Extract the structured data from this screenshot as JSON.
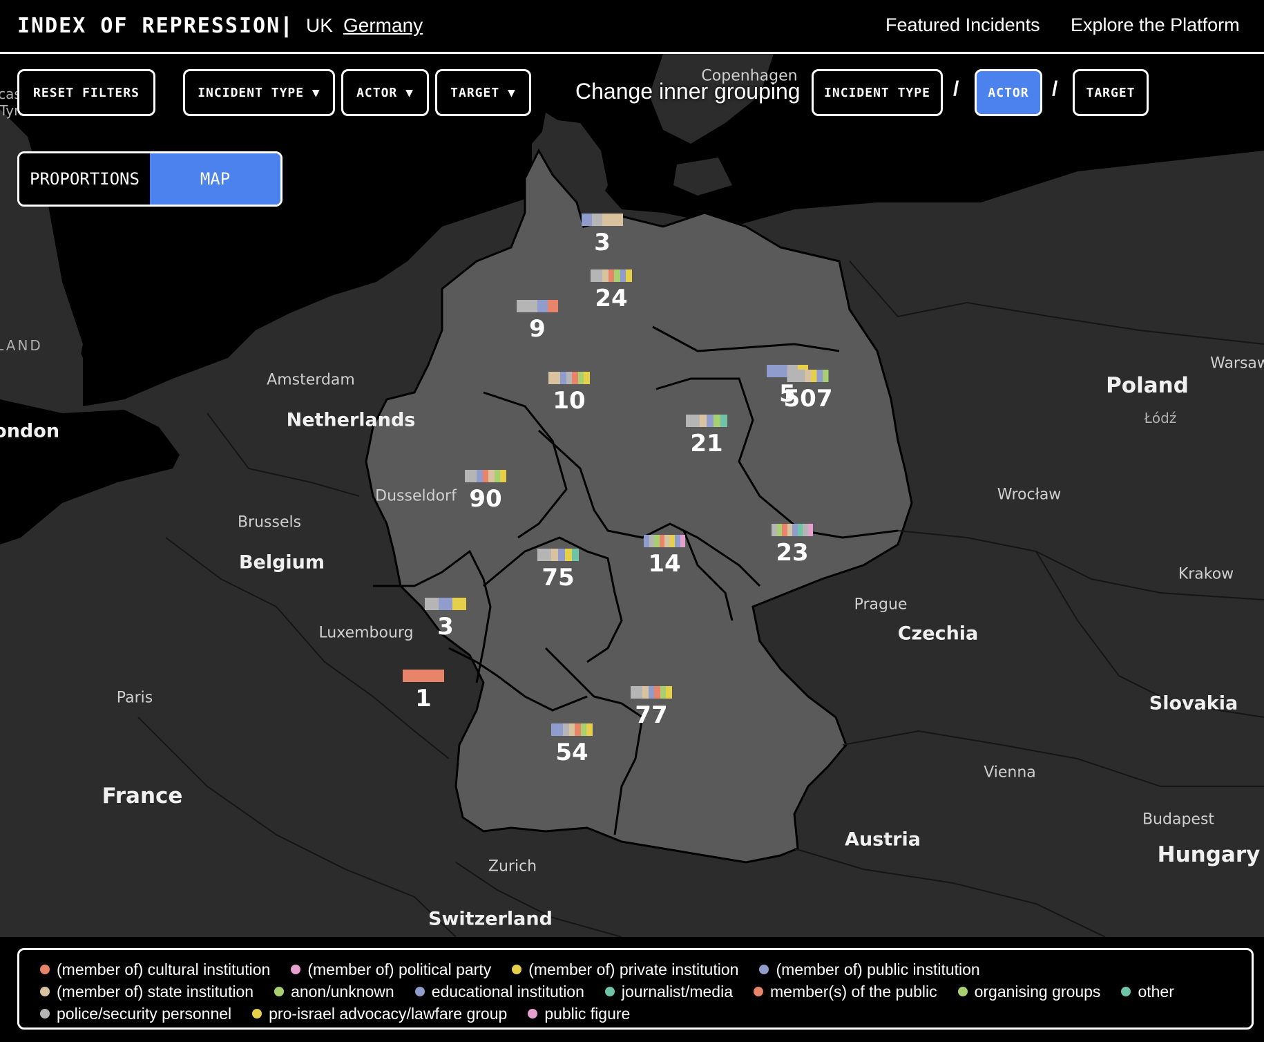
{
  "header": {
    "brand": "INDEX OF REPRESSION",
    "separator": "|",
    "countries": [
      "UK",
      "Germany"
    ],
    "active_country": "Germany",
    "nav": [
      "Featured Incidents",
      "Explore the Platform"
    ]
  },
  "controls": {
    "reset": "RESET FILTERS",
    "filters": [
      "INCIDENT TYPE ▼",
      "ACTOR ▼",
      "TARGET ▼"
    ],
    "change_label": "Change inner grouping",
    "grouping": [
      "INCIDENT TYPE",
      "ACTOR",
      "TARGET"
    ],
    "grouping_active": "ACTOR",
    "slash": "/",
    "view_toggle": [
      "PROPORTIONS",
      "MAP"
    ],
    "view_active": "MAP"
  },
  "map_labels": {
    "cities": [
      "Copenhagen",
      "Amsterdam",
      "Dusseldorf",
      "Brussels",
      "Luxembourg",
      "Paris",
      "Zurich",
      "Prague",
      "Vienna",
      "Budapest",
      "Wrocław",
      "Łódź",
      "Krakow",
      "Warsaw",
      "London"
    ],
    "countries": [
      "Netherlands",
      "Belgium",
      "France",
      "Switzerland",
      "Austria",
      "Czechia",
      "Poland",
      "Slovakia",
      "Hungary"
    ],
    "fragments": [
      "LAND",
      "cas",
      "Tyn"
    ]
  },
  "regions": [
    {
      "count": "3",
      "segments": [
        "#8f9ccc",
        "#b5b5b5",
        "#d9c2a0",
        "#d9c2a0"
      ]
    },
    {
      "count": "24",
      "segments": [
        "#b5b5b5",
        "#b5b5b5",
        "#d9c2a0",
        "#e8846a",
        "#a8d070",
        "#8f9ccc",
        "#e6d04a"
      ]
    },
    {
      "count": "9",
      "segments": [
        "#b5b5b5",
        "#b5b5b5",
        "#8f9ccc",
        "#e8846a"
      ]
    },
    {
      "count": "10",
      "segments": [
        "#d9c2a0",
        "#d9c2a0",
        "#8f9ccc",
        "#b5b5b5",
        "#e8846a",
        "#a8d070",
        "#e6d04a"
      ]
    },
    {
      "count": "5",
      "segments": [
        "#8f9ccc",
        "#8f9ccc",
        "#b5b5b5",
        "#e6d04a"
      ]
    },
    {
      "count": "507",
      "segments": [
        "#b5b5b5",
        "#b5b5b5",
        "#b5b5b5",
        "#d9c2a0",
        "#e6d04a",
        "#8f9ccc",
        "#a8d070"
      ]
    },
    {
      "count": "21",
      "segments": [
        "#b5b5b5",
        "#b5b5b5",
        "#d9c2a0",
        "#8f9ccc",
        "#a8d070",
        "#6fc4a8"
      ]
    },
    {
      "count": "90",
      "segments": [
        "#b5b5b5",
        "#b5b5b5",
        "#8f9ccc",
        "#e8846a",
        "#d9c2a0",
        "#a8d070",
        "#e6d04a"
      ]
    },
    {
      "count": "75",
      "segments": [
        "#b5b5b5",
        "#b5b5b5",
        "#d9c2a0",
        "#8f9ccc",
        "#e6d04a",
        "#6fc4a8"
      ]
    },
    {
      "count": "14",
      "segments": [
        "#8f9ccc",
        "#b5b5b5",
        "#a8d070",
        "#e8846a",
        "#d9c2a0",
        "#e6d04a",
        "#8f9ccc",
        "#e6a0d0"
      ]
    },
    {
      "count": "23",
      "segments": [
        "#b5b5b5",
        "#a8d070",
        "#e8846a",
        "#d9c2a0",
        "#8f9ccc",
        "#6fc4a8",
        "#b5b5b5",
        "#e6a0d0"
      ]
    },
    {
      "count": "3",
      "segments": [
        "#b5b5b5",
        "#8f9ccc",
        "#e6d04a"
      ]
    },
    {
      "count": "1",
      "segments": [
        "#e8846a"
      ]
    },
    {
      "count": "77",
      "segments": [
        "#b5b5b5",
        "#b5b5b5",
        "#d9c2a0",
        "#8f9ccc",
        "#e8846a",
        "#a8d070",
        "#e6d04a"
      ]
    },
    {
      "count": "54",
      "segments": [
        "#8f9ccc",
        "#8f9ccc",
        "#b5b5b5",
        "#d9c2a0",
        "#e8846a",
        "#a8d070",
        "#e6d04a"
      ]
    }
  ],
  "legend": [
    {
      "label": "(member of) cultural institution",
      "color": "#e8846a"
    },
    {
      "label": "(member of) political party",
      "color": "#e6a0d0"
    },
    {
      "label": "(member of) private institution",
      "color": "#e6d04a"
    },
    {
      "label": "(member of) public institution",
      "color": "#8f9ccc"
    },
    {
      "label": "(member of) state institution",
      "color": "#d9c2a0"
    },
    {
      "label": "anon/unknown",
      "color": "#a8d070"
    },
    {
      "label": "educational institution",
      "color": "#8f9ccc"
    },
    {
      "label": "journalist/media",
      "color": "#6fc4a8"
    },
    {
      "label": "member(s) of the public",
      "color": "#e8846a"
    },
    {
      "label": "organising groups",
      "color": "#a8d070"
    },
    {
      "label": "other",
      "color": "#6fc4a8"
    },
    {
      "label": "police/security personnel",
      "color": "#b5b5b5"
    },
    {
      "label": "pro-israel advocacy/lawfare group",
      "color": "#e6d04a"
    },
    {
      "label": "public figure",
      "color": "#e6a0d0"
    }
  ],
  "colors": {
    "accent": "#4c82ee",
    "germany_fill": "#5a5a5a",
    "land": "#2c2c2c",
    "sea": "#000000"
  }
}
